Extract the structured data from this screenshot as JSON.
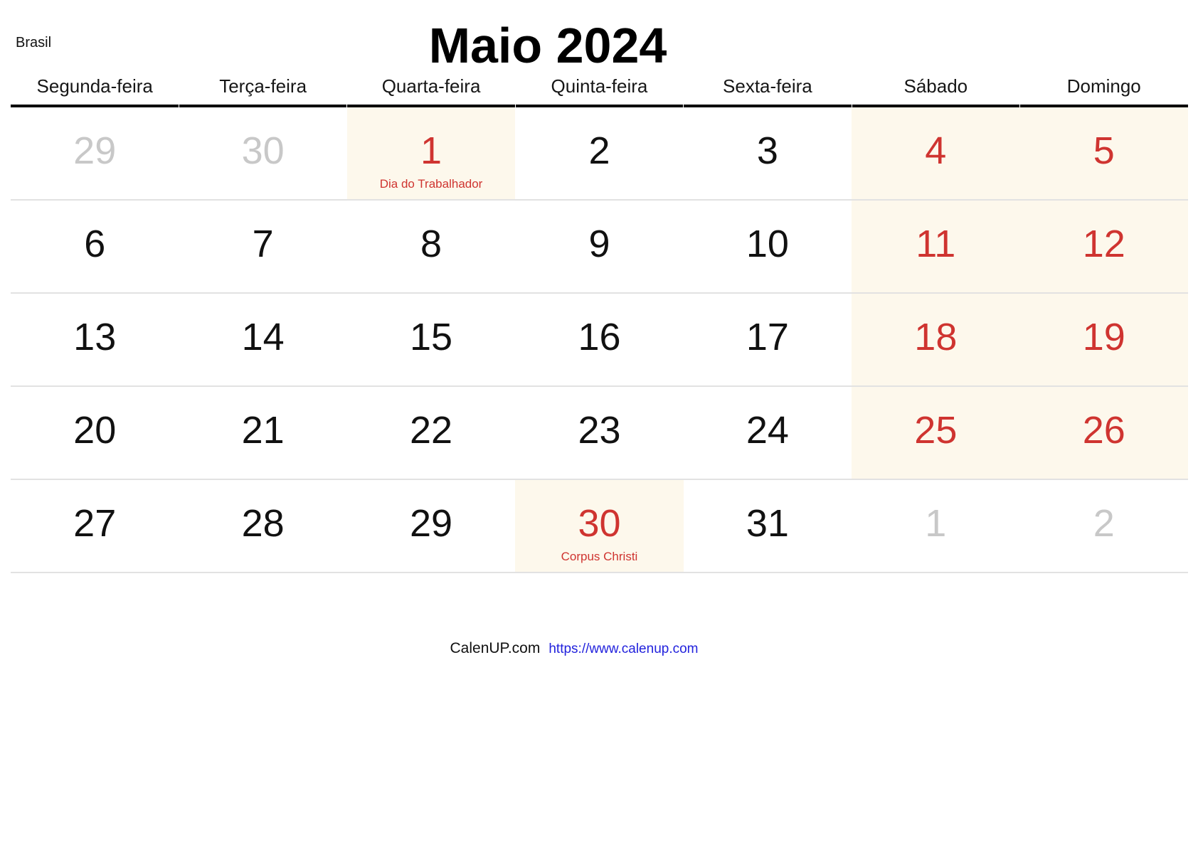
{
  "header": {
    "country": "Brasil",
    "title": "Maio 2024"
  },
  "weekdays": [
    "Segunda-feira",
    "Terça-feira",
    "Quarta-feira",
    "Quinta-feira",
    "Sexta-feira",
    "Sábado",
    "Domingo"
  ],
  "colors": {
    "holiday_red": "#cf3430",
    "weekend_red": "#cf3430",
    "shade_cream": "#fdf8ec",
    "other_month_gray": "#c8c8c8",
    "rule_black": "#000000",
    "row_line_gray": "#e2e2e2",
    "link_blue": "#2222dd"
  },
  "weeks": [
    [
      {
        "num": "29",
        "kind": "other",
        "shaded": false,
        "event": ""
      },
      {
        "num": "30",
        "kind": "other",
        "shaded": false,
        "event": ""
      },
      {
        "num": "1",
        "kind": "holiday",
        "shaded": true,
        "event": "Dia do Trabalhador"
      },
      {
        "num": "2",
        "kind": "normal",
        "shaded": false,
        "event": ""
      },
      {
        "num": "3",
        "kind": "normal",
        "shaded": false,
        "event": ""
      },
      {
        "num": "4",
        "kind": "weekend",
        "shaded": true,
        "event": ""
      },
      {
        "num": "5",
        "kind": "weekend",
        "shaded": true,
        "event": ""
      }
    ],
    [
      {
        "num": "6",
        "kind": "normal",
        "shaded": false,
        "event": ""
      },
      {
        "num": "7",
        "kind": "normal",
        "shaded": false,
        "event": ""
      },
      {
        "num": "8",
        "kind": "normal",
        "shaded": false,
        "event": ""
      },
      {
        "num": "9",
        "kind": "normal",
        "shaded": false,
        "event": ""
      },
      {
        "num": "10",
        "kind": "normal",
        "shaded": false,
        "event": ""
      },
      {
        "num": "11",
        "kind": "weekend",
        "shaded": true,
        "event": ""
      },
      {
        "num": "12",
        "kind": "weekend",
        "shaded": true,
        "event": ""
      }
    ],
    [
      {
        "num": "13",
        "kind": "normal",
        "shaded": false,
        "event": ""
      },
      {
        "num": "14",
        "kind": "normal",
        "shaded": false,
        "event": ""
      },
      {
        "num": "15",
        "kind": "normal",
        "shaded": false,
        "event": ""
      },
      {
        "num": "16",
        "kind": "normal",
        "shaded": false,
        "event": ""
      },
      {
        "num": "17",
        "kind": "normal",
        "shaded": false,
        "event": ""
      },
      {
        "num": "18",
        "kind": "weekend",
        "shaded": true,
        "event": ""
      },
      {
        "num": "19",
        "kind": "weekend",
        "shaded": true,
        "event": ""
      }
    ],
    [
      {
        "num": "20",
        "kind": "normal",
        "shaded": false,
        "event": ""
      },
      {
        "num": "21",
        "kind": "normal",
        "shaded": false,
        "event": ""
      },
      {
        "num": "22",
        "kind": "normal",
        "shaded": false,
        "event": ""
      },
      {
        "num": "23",
        "kind": "normal",
        "shaded": false,
        "event": ""
      },
      {
        "num": "24",
        "kind": "normal",
        "shaded": false,
        "event": ""
      },
      {
        "num": "25",
        "kind": "weekend",
        "shaded": true,
        "event": ""
      },
      {
        "num": "26",
        "kind": "weekend",
        "shaded": true,
        "event": ""
      }
    ],
    [
      {
        "num": "27",
        "kind": "normal",
        "shaded": false,
        "event": ""
      },
      {
        "num": "28",
        "kind": "normal",
        "shaded": false,
        "event": ""
      },
      {
        "num": "29",
        "kind": "normal",
        "shaded": false,
        "event": ""
      },
      {
        "num": "30",
        "kind": "holiday",
        "shaded": true,
        "event": "Corpus Christi"
      },
      {
        "num": "31",
        "kind": "normal",
        "shaded": false,
        "event": ""
      },
      {
        "num": "1",
        "kind": "other",
        "shaded": false,
        "event": ""
      },
      {
        "num": "2",
        "kind": "other",
        "shaded": false,
        "event": ""
      }
    ]
  ],
  "footer": {
    "brand": "CalenUP.com",
    "url": "https://www.calenup.com"
  }
}
